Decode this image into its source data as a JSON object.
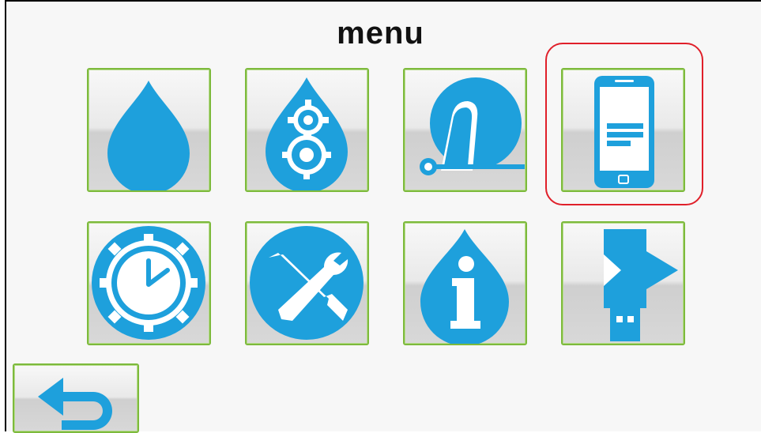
{
  "title": "menu",
  "accent_color": "#1ea0dc",
  "tile_border_color": "#7dba3c",
  "highlight_color": "#e0202a",
  "tiles": [
    {
      "icon": "water-drop-icon"
    },
    {
      "icon": "drop-gears-icon"
    },
    {
      "icon": "dosing-pump-icon"
    },
    {
      "icon": "smartphone-icon",
      "highlighted": true
    },
    {
      "icon": "clock-gear-icon"
    },
    {
      "icon": "tools-icon"
    },
    {
      "icon": "info-drop-icon"
    },
    {
      "icon": "usb-export-icon"
    }
  ],
  "back_button": {
    "icon": "back-arrow-icon"
  }
}
